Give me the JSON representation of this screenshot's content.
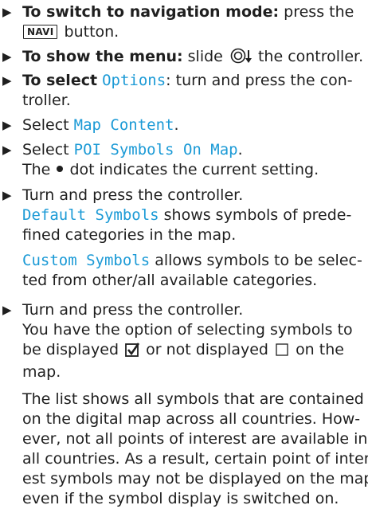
{
  "bullet_icon": "triangle-right",
  "steps": [
    {
      "lead": "To switch to navigation mode:",
      "text1": "press the",
      "key": "NAVI",
      "text2": "button."
    },
    {
      "lead": "To show the menu:",
      "text1": "slide",
      "icon": "controller-slide-down",
      "text2": "the controller."
    },
    {
      "lead": "To select",
      "term": "Options",
      "text1": ": turn and press the con-",
      "text2": "troller."
    },
    {
      "text1": "Select",
      "term": "Map Content",
      "text2": "."
    },
    {
      "text1": "Select",
      "term": "POI Symbols On Map",
      "text2": ".",
      "note1": "The",
      "note2": "dot indicates the current setting."
    },
    {
      "text1": "Turn and press the controller.",
      "term1": "Default Symbols",
      "line2": "shows symbols of prede-",
      "line3": "fined categories in the map.",
      "term2": "Custom Symbols",
      "line4": "allows symbols to be selec-",
      "line5": "ted from other/all available categories."
    },
    {
      "text1": "Turn and press the controller.",
      "line2": "You have the option of selecting symbols to",
      "line3a": "be displayed",
      "line3b": "or not displayed",
      "line3c": "on the",
      "line4": "map.",
      "para": [
        "The list shows all symbols that are contained",
        "on the digital map across all countries. How-",
        "ever, not all points of interest are available in",
        "all countries. As a result, certain point of inter-",
        "est symbols may not be displayed on the map,",
        "even if the symbol display is switched on."
      ]
    }
  ]
}
